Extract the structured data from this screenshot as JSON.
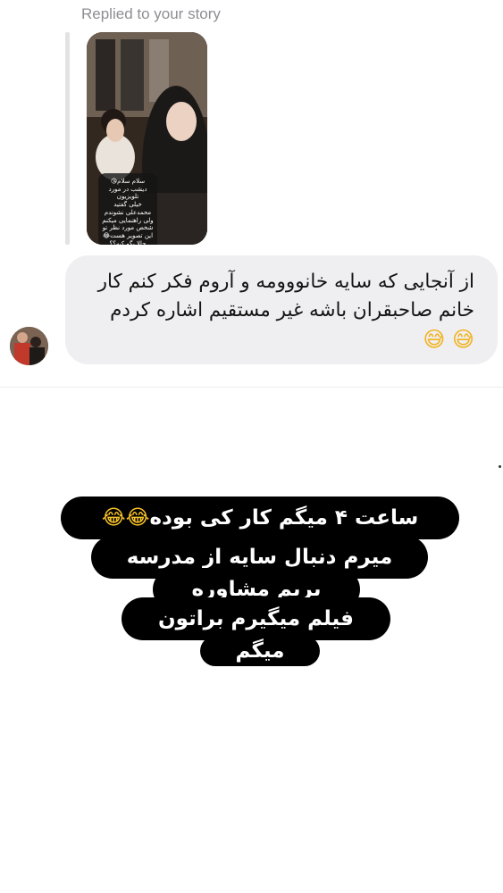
{
  "reply": {
    "label": "Replied to your story",
    "story_caption": "سلام سلام😘\nدیشب در مورد تلویزیون\nخیلی گفتید\nمحمدعلی نشوندم\nولی راهنمایی میکنم\nشخص مورد نظر تو\nاین تصویر هست😂\nحالا بگو کیه؟؟"
  },
  "message": {
    "line1": "از آنجایی که سایه خانووومه و آروم فکر کنم کار",
    "line2": "خانم صاحبقران باشه  غیر مستقیم اشاره کردم",
    "emoji": "😅 😅"
  },
  "overlay": {
    "line1_text": "ساعت ۴ میگم کار کی بوده",
    "line1_emoji": "😂😂",
    "line2": "میرم دنبال سایه از مدرسه",
    "line3": "بریم مشاوره",
    "line4": "فیلم میگیرم براتون",
    "line5": "میگم"
  }
}
